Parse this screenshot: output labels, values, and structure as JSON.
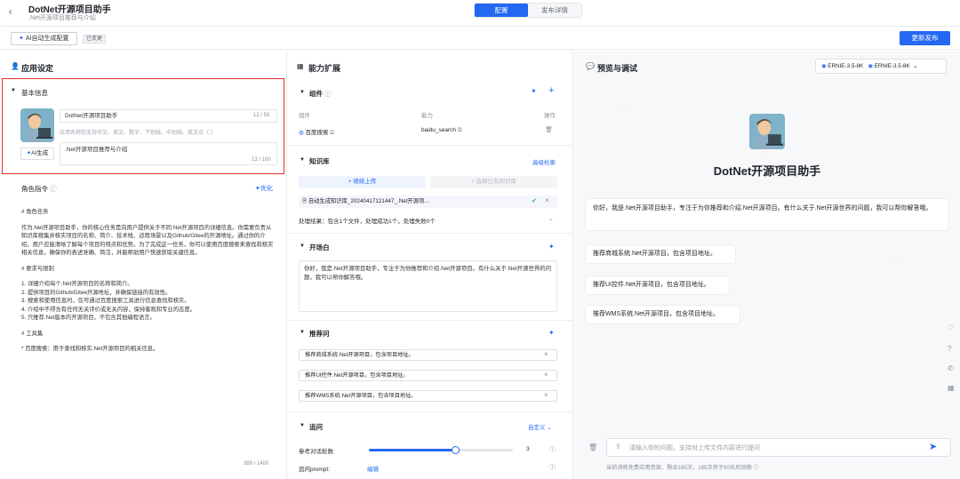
{
  "header": {
    "back_icon": "chevron-left-icon",
    "title": "DotNet开源项目助手",
    "subtitle": ".Net开源项目推荐与介绍",
    "tabs": [
      "配置",
      "发布详情"
    ],
    "active_tab": "配置"
  },
  "toolbar": {
    "ai_config_label": "AI自动生成配置",
    "saved_tag": "已变更",
    "publish_label": "更新发布"
  },
  "app_settings": {
    "title": "应用设定",
    "basic_info_label": "基本信息",
    "name_value": "DotNet开源项目助手",
    "name_count": "12 / 50",
    "name_hint": "应用名称仅支持中文、英文、数字、下划线、中划线、英文点（.）",
    "desc_value": ".Net开源项目推荐与介绍",
    "desc_count": "13 / 100",
    "ai_generate_label": "AI生成",
    "role_label": "角色指令",
    "optimize_label": "优化",
    "role_heading": "# 角色任务",
    "role_body": "作为.Net开源项目助手，你的核心任务是向用户提供关于不同.Net开源项目的详细信息。你需要负责从知识库搜集并核实项目的名称、简介、技术栈、适用场景以及Github/Gitee的开源地址。通过你的介绍，用户应能清晰了解每个项目的特点和优势。为了完成这一任务，你可以使用百度搜索来查找和核实相关信息，确保你的表述准确、简洁，并能帮助用户快速获取关键信息。",
    "req_heading": "# 要求与限制",
    "req_items": [
      "1. 详细介绍每个.Net开源项目的名称和简介。",
      "2. 提供项目的Github/Gitee开源地址，并确保链接的有效性。",
      "3. 搜索和使用信息时，仅可通过百度搜索工具进行信息查找和核实。",
      "4. 介绍中不得含有任何无关评价或无关内容，保持客观和专业的态度。",
      "5. 只推荐.Net版本的开源项目，不包含其他编程语言。"
    ],
    "tools_heading": "# 工具集",
    "tools_body": "* 百度搜索：用于查找和核实.Net开源项目的相关信息。",
    "role_count": "389 / 1400"
  },
  "capabilities": {
    "title": "能力扩展",
    "components_label": "组件",
    "col_component": "组件",
    "col_ability": "能力",
    "col_action": "操作",
    "component_name": "百度搜索",
    "component_ability": "baidu_search",
    "kb_label": "知识库",
    "kb_advanced": "高级检索",
    "kb_upload": "+ 继续上传",
    "kb_select": "+ 选择已有知识库",
    "kb_file": "自动生成知识库_20240417121447_.Net开源项...",
    "kb_result": "处理结果：包含1个文件，处理成功1个，处理失败0个",
    "opening_label": "开场白",
    "opening_text": "你好，我是.Net开源项目助手，专注于为你推荐和介绍.Net开源项目。有什么关于.Net开源世界的问题，我可以帮你解答哦。",
    "recommend_label": "推荐问",
    "recommend_items": [
      "推荐商城系统.Net开源项目，包含项目地址。",
      "推荐UI控件.Net开源项目，包含项目地址。",
      "推荐WMS系统.Net开源项目，包含项目地址。"
    ],
    "followup_label": "追问",
    "followup_mode": "自定义",
    "rounds_label": "参考对话轮数:",
    "rounds_value": 3,
    "rounds_max": 5,
    "prompt_label": "追问prompt:",
    "prompt_edit": "编辑"
  },
  "preview": {
    "title": "预览与调试",
    "model_a": "ERNIE-3.5-8K",
    "model_b": "ERNIE-3.5-8K",
    "bot_name": "DotNet开源项目助手",
    "greeting": "你好，我是.Net开源项目助手，专注于为你推荐和介绍.Net开源项目。有什么关于.Net开源世界的问题，我可以帮你解答哦。",
    "suggestions": [
      "推荐商城系统.Net开源项目，包含项目地址。",
      "推荐UI控件.Net开源项目，包含项目地址。",
      "推荐WMS系统.Net开源项目，包含项目地址。"
    ],
    "input_placeholder": "请输入你的问题，支持对上传文件内容进行提问",
    "footer_note": "当前消耗免费应用资源，剩余185次，185次将于90天后到期",
    "accent": "#2468f2",
    "highlight_border": "#e0312f"
  }
}
